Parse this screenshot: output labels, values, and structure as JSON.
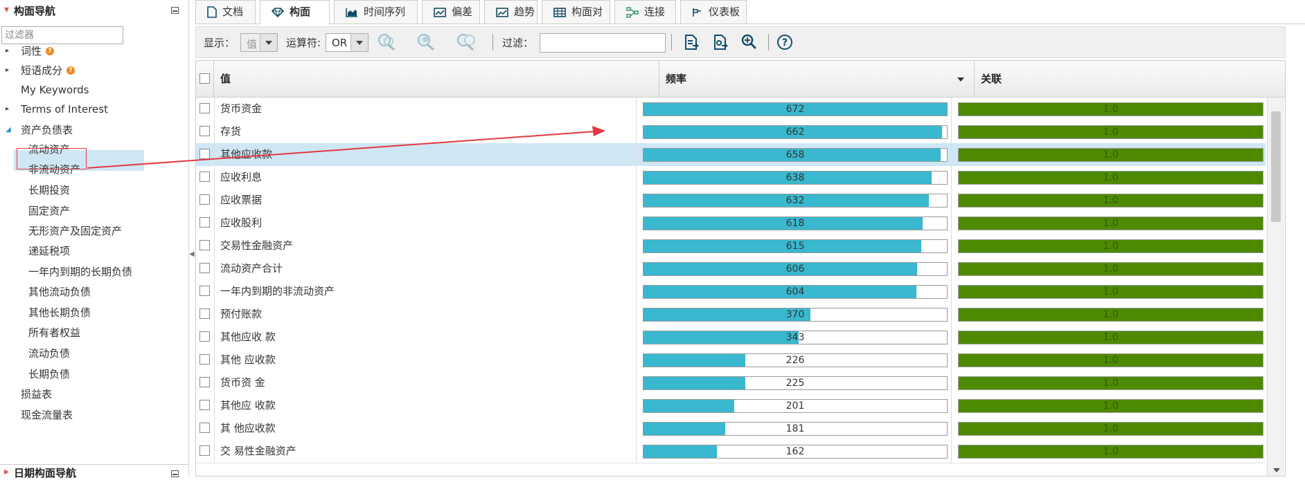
{
  "left_panel": {
    "title": "构面导航",
    "filter_placeholder": "过滤器",
    "tree": [
      {
        "label": "词性",
        "arrow": "closed",
        "help": true
      },
      {
        "label": "短语成分",
        "arrow": "closed",
        "help": true
      },
      {
        "label": "My Keywords"
      },
      {
        "label": "Terms of Interest",
        "arrow": "closed"
      },
      {
        "label": "资产负债表",
        "arrow": "open"
      },
      {
        "label": "流动资产",
        "child": true,
        "selected": true
      },
      {
        "label": "非流动资产",
        "child": true
      },
      {
        "label": "长期投资",
        "child": true
      },
      {
        "label": "固定资产",
        "child": true
      },
      {
        "label": "无形资产及固定资产",
        "child": true
      },
      {
        "label": "递延税项",
        "child": true
      },
      {
        "label": "一年内到期的长期负债",
        "child": true
      },
      {
        "label": "其他流动负债",
        "child": true
      },
      {
        "label": "其他长期负债",
        "child": true
      },
      {
        "label": "所有者权益",
        "child": true
      },
      {
        "label": "流动负债",
        "child": true
      },
      {
        "label": "长期负债",
        "child": true
      },
      {
        "label": "损益表"
      },
      {
        "label": "现金流量表"
      }
    ],
    "second_title": "日期构面导航"
  },
  "tabs": [
    {
      "label": "文档",
      "icon": "document-icon"
    },
    {
      "label": "构面",
      "icon": "diamond-icon",
      "active": true
    },
    {
      "label": "时间序列",
      "icon": "area-chart-icon"
    },
    {
      "label": "偏差",
      "icon": "line-chart-icon"
    },
    {
      "label": "趋势",
      "icon": "trend-chart-icon"
    },
    {
      "label": "构面对",
      "icon": "table-grid-icon"
    },
    {
      "label": "连接",
      "icon": "network-icon"
    },
    {
      "label": "仪表板",
      "icon": "dashboard-icon"
    }
  ],
  "toolbar": {
    "display_label": "显示：",
    "display_value": "值",
    "operator_label": "运算符:",
    "operator_value": "OR",
    "filter_label": "过滤：",
    "filter_value": ""
  },
  "grid": {
    "headers": {
      "value": "值",
      "frequency": "频率",
      "correlation": "关联"
    },
    "max_frequency": 672,
    "rows": [
      {
        "value": "货币资金",
        "frequency": 672,
        "correlation": "1.0"
      },
      {
        "value": "存货",
        "frequency": 662,
        "correlation": "1.0"
      },
      {
        "value": "其他应收款",
        "frequency": 658,
        "correlation": "1.0",
        "selected": true
      },
      {
        "value": "应收利息",
        "frequency": 638,
        "correlation": "1.0"
      },
      {
        "value": "应收票据",
        "frequency": 632,
        "correlation": "1.0"
      },
      {
        "value": "应收股利",
        "frequency": 618,
        "correlation": "1.0"
      },
      {
        "value": "交易性金融资产",
        "frequency": 615,
        "correlation": "1.0"
      },
      {
        "value": "流动资产合计",
        "frequency": 606,
        "correlation": "1.0"
      },
      {
        "value": "一年内到期的非流动资产",
        "frequency": 604,
        "correlation": "1.0"
      },
      {
        "value": "预付账款",
        "frequency": 370,
        "correlation": "1.0"
      },
      {
        "value": "其他应收 款",
        "frequency": 343,
        "correlation": "1.0"
      },
      {
        "value": "其他 应收款",
        "frequency": 226,
        "correlation": "1.0"
      },
      {
        "value": "货币资 金",
        "frequency": 225,
        "correlation": "1.0"
      },
      {
        "value": "其他应 收款",
        "frequency": 201,
        "correlation": "1.0"
      },
      {
        "value": "其 他应收款",
        "frequency": 181,
        "correlation": "1.0"
      },
      {
        "value": "交 易性金融资产",
        "frequency": 162,
        "correlation": "1.0"
      }
    ]
  },
  "colors": {
    "frequency_bar": "#39b8cf",
    "correlation_bar": "#4d8a00",
    "selection": "#cfe7f5",
    "annotation": "#e0393e"
  }
}
